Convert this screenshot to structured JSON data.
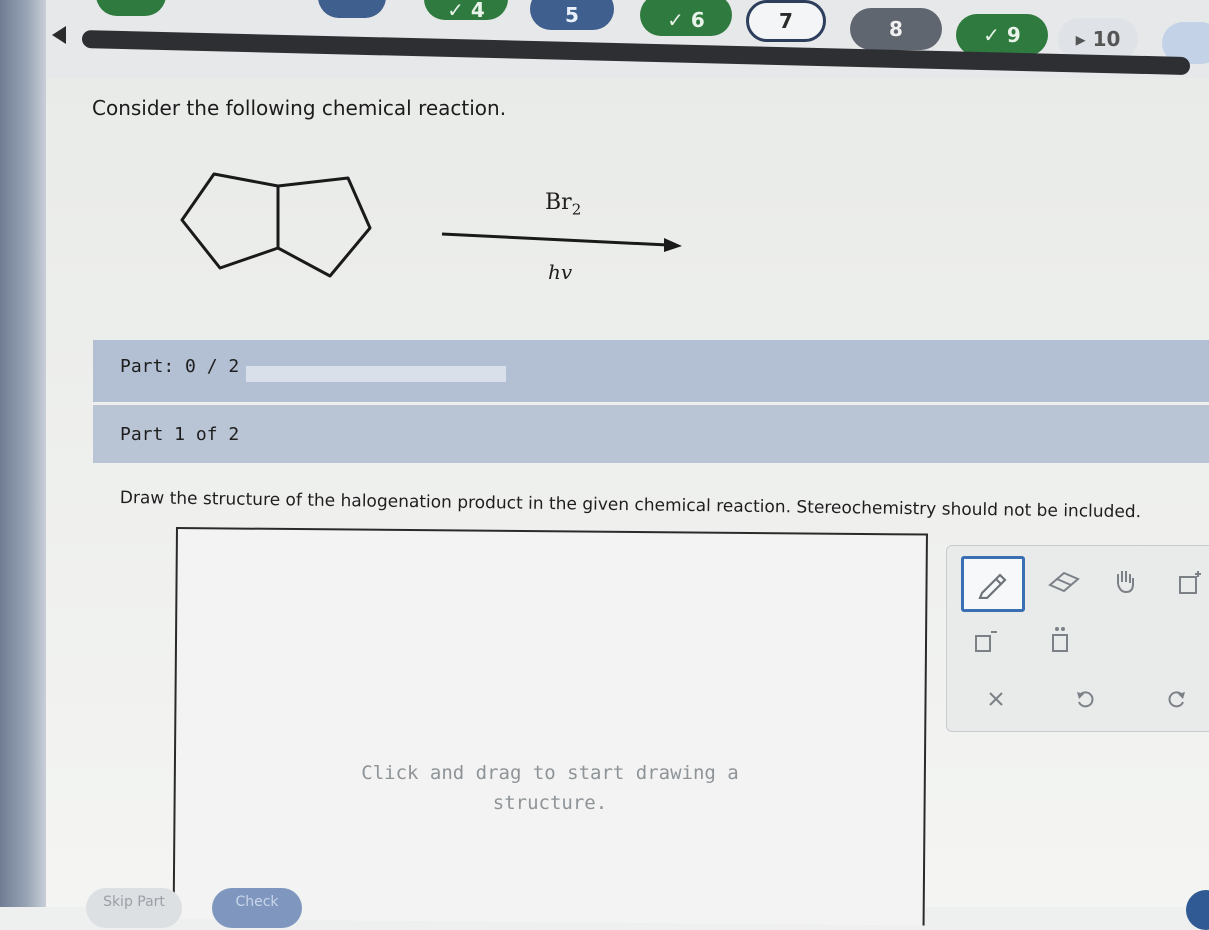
{
  "nav": {
    "items": [
      {
        "label": "✓ 4",
        "state": "answered"
      },
      {
        "label": "5",
        "state": "current"
      },
      {
        "label": "✓ 6",
        "state": "answered"
      },
      {
        "label": "7",
        "state": "selected"
      },
      {
        "label": "8",
        "state": "unanswered"
      },
      {
        "label": "✓ 9",
        "state": "answered"
      },
      {
        "label": "▸ 10",
        "state": "flagged"
      }
    ]
  },
  "question": {
    "prompt": "Consider the following chemical reaction.",
    "reagent_top": "Br",
    "reagent_top_subscript": "2",
    "reagent_bottom": "hv"
  },
  "part": {
    "score": "Part: 0 / 2",
    "current": "Part 1 of 2",
    "instruction": "Draw the structure of the halogenation product in the given chemical reaction. Stereochemistry should not be included."
  },
  "canvas": {
    "hint_line1": "Click and drag to start drawing a",
    "hint_line2": "structure."
  },
  "toolbox": {
    "tools": [
      "pencil-icon",
      "eraser-icon",
      "hand-icon",
      "expand-icon",
      "charge-icon",
      "lone-pair-icon",
      "clear-icon",
      "undo-icon",
      "redo-icon"
    ]
  },
  "footer": {
    "skip_label": "Skip Part",
    "check_label": "Check"
  },
  "colors": {
    "answered": "#2f7a3e",
    "current": "#3f5f8f",
    "part_bar": "#b3c0d3",
    "tool_selected": "#3b6fb3"
  }
}
